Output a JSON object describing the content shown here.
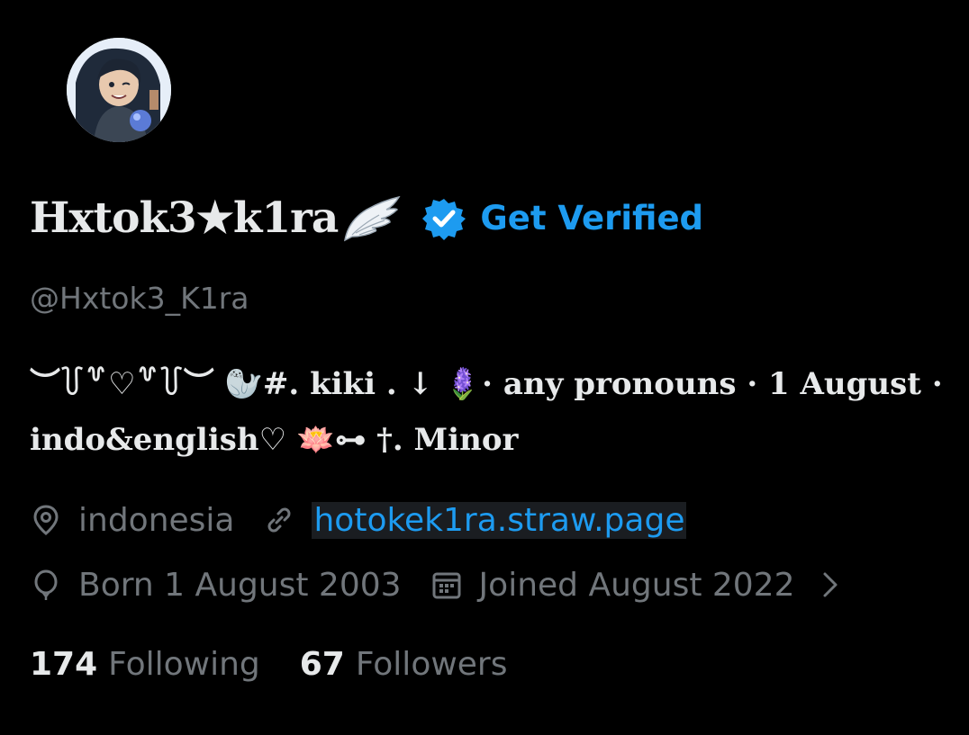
{
  "profile": {
    "display_name": "Hxtok3★k1ra",
    "get_verified_label": "Get Verified",
    "handle": "@Hxtok3_K1ra",
    "bio_line1": "︶꒦꒷♡꒷꒦︶ 🦭#. kiki . ↓ 🪻· any pronouns · 1 August ·",
    "bio_line2": "indo&english♡ 🪷⊶ †. Minor",
    "location": "indonesia",
    "website": "hotokek1ra.straw.page",
    "born": "Born 1 August 2003",
    "joined": "Joined August 2022",
    "following_count": "174",
    "following_label": "Following",
    "followers_count": "67",
    "followers_label": "Followers"
  },
  "icons": {
    "wing": "wing-icon",
    "verified": "verified-badge-icon",
    "location": "location-pin-icon",
    "link": "link-icon",
    "born": "balloon-icon",
    "joined": "calendar-icon",
    "chevron": "chevron-right-icon"
  },
  "colors": {
    "background": "#000000",
    "text": "#e7e9ea",
    "muted": "#71767b",
    "accent": "#1d9bf0"
  }
}
